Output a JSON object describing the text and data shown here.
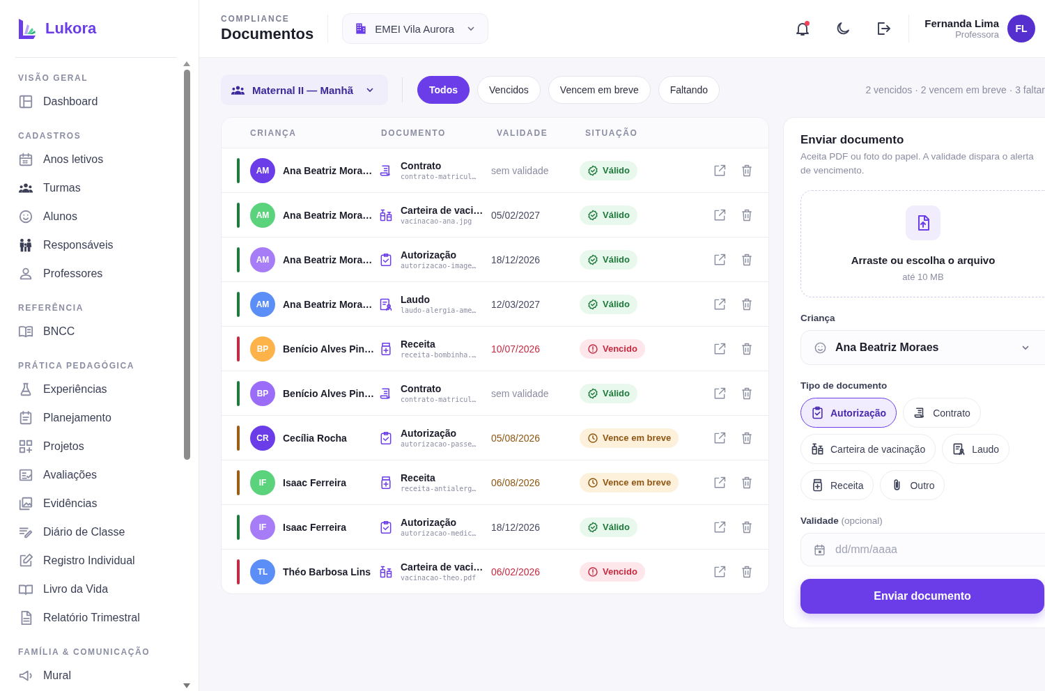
{
  "brand": {
    "name": "Lukora"
  },
  "sidebar": {
    "sections": [
      {
        "title": "VISÃO GERAL",
        "items": [
          "Dashboard"
        ]
      },
      {
        "title": "CADASTROS",
        "items": [
          "Anos letivos",
          "Turmas",
          "Alunos",
          "Responsáveis",
          "Professores"
        ]
      },
      {
        "title": "REFERÊNCIA",
        "items": [
          "BNCC"
        ]
      },
      {
        "title": "PRÁTICA PEDAGÓGICA",
        "items": [
          "Experiências",
          "Planejamento",
          "Projetos",
          "Avaliações",
          "Evidências",
          "Diário de Classe",
          "Registro Individual",
          "Livro da Vida",
          "Relatório Trimestral"
        ]
      },
      {
        "title": "FAMÍLIA & COMUNICAÇÃO",
        "items": [
          "Mural"
        ]
      }
    ]
  },
  "header": {
    "eyebrow": "COMPLIANCE",
    "title": "Documentos",
    "school": "EMEI Vila Aurora",
    "unread_notifications": true,
    "user": {
      "name": "Fernanda Lima",
      "role": "Professora",
      "initials": "FL"
    }
  },
  "filters": {
    "class_select": "Maternal II — Manhã",
    "chips": [
      {
        "label": "Todos",
        "selected": true
      },
      {
        "label": "Vencidos",
        "selected": false
      },
      {
        "label": "Vencem em breve",
        "selected": false
      },
      {
        "label": "Faltando",
        "selected": false
      }
    ],
    "summary": "2 vencidos · 2 vencem em breve · 3 faltar"
  },
  "table": {
    "columns": [
      "CRIANÇA",
      "DOCUMENTO",
      "VALIDADE",
      "SITUAÇÃO"
    ],
    "rows": [
      {
        "kind": "valid",
        "initials": "AM",
        "color": "#6a3de8",
        "child": "Ana Beatriz Mora…",
        "document": {
          "kind": "contract",
          "name": "Contrato",
          "file": "contrato-matricul…"
        },
        "validity": {
          "kind": "none",
          "text": "sem validade"
        },
        "badge": "Válido"
      },
      {
        "kind": "valid",
        "initials": "AM",
        "color": "#5bd37c",
        "child": "Ana Beatriz Mora…",
        "document": {
          "kind": "vaccine",
          "name": "Carteira de vaci…",
          "file": "vacinacao-ana.jpg"
        },
        "validity": {
          "kind": "date",
          "text": "05/02/2027"
        },
        "badge": "Válido"
      },
      {
        "kind": "valid",
        "initials": "AM",
        "color": "#a77cf7",
        "child": "Ana Beatriz Mora…",
        "document": {
          "kind": "clipboard",
          "name": "Autorização",
          "file": "autorizacao-image…"
        },
        "validity": {
          "kind": "date",
          "text": "18/12/2026"
        },
        "badge": "Válido"
      },
      {
        "kind": "valid",
        "initials": "AM",
        "color": "#5b8ef7",
        "child": "Ana Beatriz Mora…",
        "document": {
          "kind": "report",
          "name": "Laudo",
          "file": "laudo-alergia-ame…"
        },
        "validity": {
          "kind": "date",
          "text": "12/03/2027"
        },
        "badge": "Válido"
      },
      {
        "kind": "expired",
        "initials": "BP",
        "color": "#fdb24a",
        "child": "Benício Alves Pin…",
        "document": {
          "kind": "medicine",
          "name": "Receita",
          "file": "receita-bombinha.…"
        },
        "validity": {
          "kind": "date",
          "text": "10/07/2026"
        },
        "badge": "Vencido"
      },
      {
        "kind": "valid",
        "initials": "BP",
        "color": "#9b6cf7",
        "child": "Benício Alves Pin…",
        "document": {
          "kind": "contract",
          "name": "Contrato",
          "file": "contrato-matricul…"
        },
        "validity": {
          "kind": "none",
          "text": "sem validade"
        },
        "badge": "Válido"
      },
      {
        "kind": "soon",
        "initials": "CR",
        "color": "#6a3de8",
        "child": "Cecília Rocha",
        "document": {
          "kind": "clipboard",
          "name": "Autorização",
          "file": "autorizacao-passe…"
        },
        "validity": {
          "kind": "date",
          "text": "05/08/2026"
        },
        "badge": "Vence em breve"
      },
      {
        "kind": "soon",
        "initials": "IF",
        "color": "#5bd37c",
        "child": "Isaac Ferreira",
        "document": {
          "kind": "medicine",
          "name": "Receita",
          "file": "receita-antialerg…"
        },
        "validity": {
          "kind": "date",
          "text": "06/08/2026"
        },
        "badge": "Vence em breve"
      },
      {
        "kind": "valid",
        "initials": "IF",
        "color": "#a77cf7",
        "child": "Isaac Ferreira",
        "document": {
          "kind": "clipboard",
          "name": "Autorização",
          "file": "autorizacao-medic…"
        },
        "validity": {
          "kind": "date",
          "text": "18/12/2026"
        },
        "badge": "Válido"
      },
      {
        "kind": "expired",
        "initials": "TL",
        "color": "#5b8ef7",
        "child": "Théo Barbosa Lins",
        "document": {
          "kind": "vaccine",
          "name": "Carteira de vaci…",
          "file": "vacinacao-theo.pdf"
        },
        "validity": {
          "kind": "date",
          "text": "06/02/2026"
        },
        "badge": "Vencido"
      }
    ]
  },
  "upload": {
    "title": "Enviar documento",
    "description": "Aceita PDF ou foto do papel. A validade dispara o alerta de vencimento.",
    "dropzone_title": "Arraste ou escolha o arquivo",
    "dropzone_hint": "até 10 MB",
    "child_label": "Criança",
    "child_value": "Ana Beatriz Moraes",
    "type_label": "Tipo de documento",
    "types": [
      {
        "label": "Autorização",
        "kind": "clipboard",
        "selected": true
      },
      {
        "label": "Contrato",
        "kind": "contract",
        "selected": false
      },
      {
        "label": "Carteira de vacinação",
        "kind": "vaccine",
        "selected": false
      },
      {
        "label": "Laudo",
        "kind": "report",
        "selected": false
      },
      {
        "label": "Receita",
        "kind": "medicine",
        "selected": false
      },
      {
        "label": "Outro",
        "kind": "paperclip",
        "selected": false
      }
    ],
    "validity_label": "Validade",
    "validity_optional": "(opcional)",
    "validity_placeholder": "dd/mm/aaaa",
    "submit": "Enviar documento"
  }
}
